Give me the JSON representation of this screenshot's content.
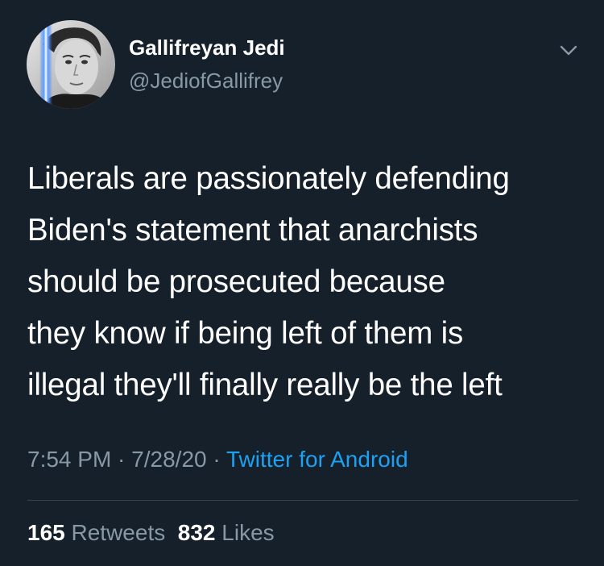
{
  "author": {
    "display_name": "Gallifreyan Jedi",
    "handle": "@JediofGallifrey",
    "avatar_icon": "avatar-photo"
  },
  "menu": {
    "icon": "chevron-down-icon"
  },
  "tweet": {
    "text": "Liberals are passionately defending\nBiden's statement that anarchists\nshould be prosecuted because\nthey know if being left of them is\nillegal they'll finally really be the left"
  },
  "meta": {
    "time": "7:54 PM",
    "sep1": " · ",
    "date": "7/28/20",
    "sep2": " · ",
    "source": "Twitter for Android"
  },
  "stats": {
    "retweets_count": "165",
    "retweets_label": "Retweets",
    "likes_count": "832",
    "likes_label": "Likes"
  },
  "colors": {
    "background": "#15202b",
    "primary_text": "#ffffff",
    "secondary_text": "#8899a6",
    "link": "#1da1f2",
    "divider": "#38444d"
  }
}
